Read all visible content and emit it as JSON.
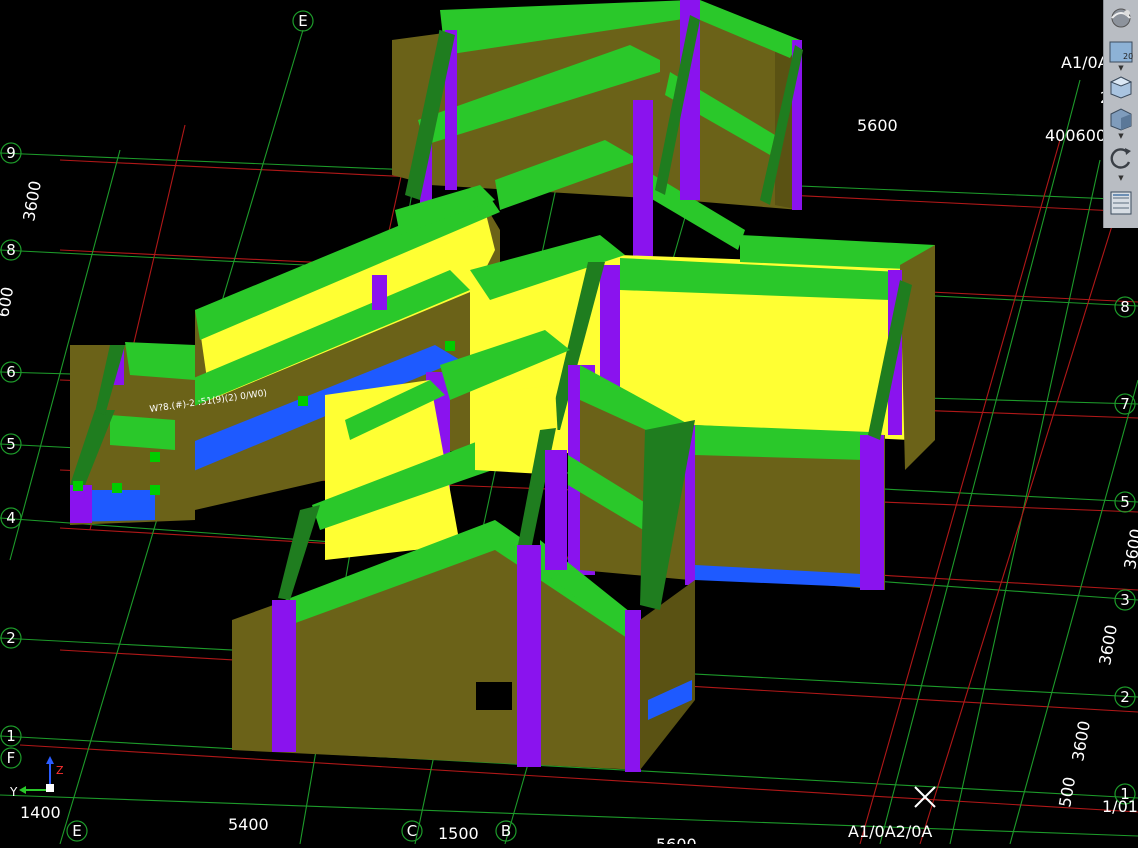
{
  "grid_axes": {
    "E_top": "E",
    "row9_left": "9",
    "row8_left": "8",
    "row6_left": "6",
    "row5_left": "5",
    "row4_left": "4",
    "row2_left": "2",
    "row1_left": "1",
    "F_left": "F",
    "row8_right": "8",
    "row7_right": "7",
    "row5_right": "5",
    "row3_right": "3",
    "row2_right": "2",
    "row1_right": "1",
    "E_bottom": "E",
    "C_bottom": "C",
    "B_bottom": "B"
  },
  "labels": {
    "a1_0a_top_right": "A1/0A",
    "a1_0a_2_0a_bottom": "A1/0A2/0A",
    "right_edge_top_fragment": "2",
    "right_edge_bottom_fragment": "1/01"
  },
  "dimensions": {
    "left_3600": "3600",
    "left_partial": "600",
    "top_5600": "5600",
    "top_400600": "400600",
    "right_3600_a": "3600",
    "right_3600_b": "3600",
    "right_3600_c": "3600",
    "right_500": "500",
    "bottom_1400": "1400",
    "bottom_5400": "5400",
    "bottom_1500": "1500",
    "bottom_5600": "5600"
  },
  "selected_object_label": "W?8.(#)-2 :51(9)(2) 0/W0)",
  "ucs": {
    "x_label": "X",
    "y_label": "Y",
    "z_label": "Z"
  },
  "toolbar": {
    "buttons": [
      "navigation-wheel-icon",
      "view-front-20-icon",
      "view-top-cube-icon",
      "view-iso-cube-icon",
      "orbit-icon",
      "layer-manager-icon"
    ],
    "view_badge": "20"
  },
  "colors": {
    "background": "#000000",
    "grid_green": "#1d9a2a",
    "grid_red": "#b01818",
    "wall": "#6b6218",
    "column": "#8a13ee",
    "beam": "#2ac82a",
    "slab": "#ffff33",
    "floor": "#1e5aff"
  }
}
